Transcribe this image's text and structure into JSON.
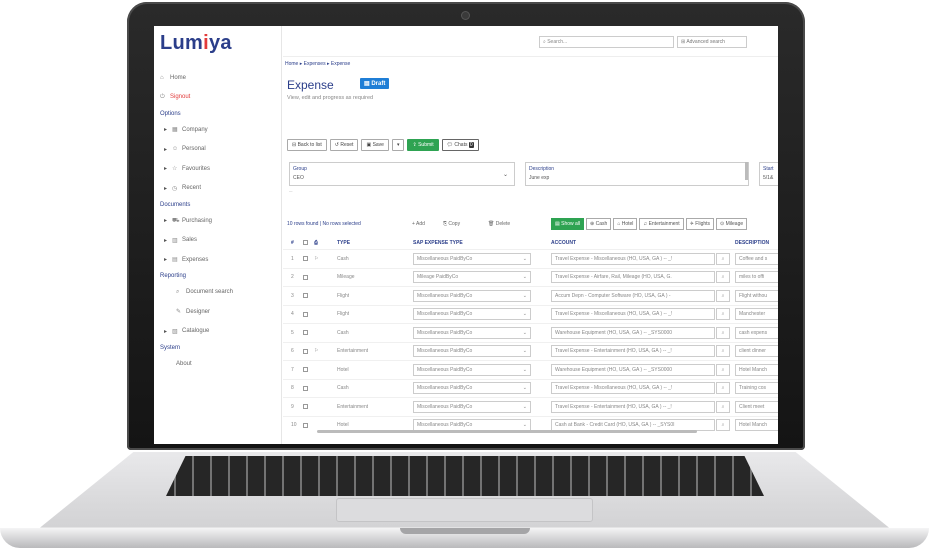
{
  "app": {
    "logo": "Lumiya",
    "logo_mark": "·"
  },
  "search": {
    "placeholder": "Search...",
    "advanced_label": "Advanced search"
  },
  "sidebar": {
    "items": [
      {
        "label": "Home",
        "icon": "home-icon",
        "style": "plain"
      },
      {
        "label": "Signout",
        "icon": "signout-icon",
        "style": "red"
      },
      {
        "label": "Options",
        "style": "section"
      },
      {
        "label": "Company",
        "icon": "building-icon",
        "style": "child"
      },
      {
        "label": "Personal",
        "icon": "person-icon",
        "style": "child"
      },
      {
        "label": "Favourites",
        "icon": "star-icon",
        "style": "child"
      },
      {
        "label": "Recent",
        "icon": "clock-icon",
        "style": "child"
      },
      {
        "label": "Documents",
        "style": "section"
      },
      {
        "label": "Purchasing",
        "icon": "cart-icon",
        "style": "child"
      },
      {
        "label": "Sales",
        "icon": "sales-icon",
        "style": "child"
      },
      {
        "label": "Expenses",
        "icon": "receipt-icon",
        "style": "child"
      },
      {
        "label": "Reporting",
        "style": "section"
      },
      {
        "label": "Document search",
        "icon": "doc-search-icon",
        "style": "sub"
      },
      {
        "label": "Designer",
        "icon": "designer-icon",
        "style": "sub"
      },
      {
        "label": "Catalogue",
        "icon": "catalogue-icon",
        "style": "child"
      },
      {
        "label": "System",
        "style": "section"
      },
      {
        "label": "About",
        "style": "sub"
      }
    ]
  },
  "breadcrumb": "Home ▸ Expenses ▸ Expense",
  "page": {
    "title": "Expense",
    "status_badge": "Draft",
    "subtitle": "View, edit and progress as required"
  },
  "toolbar": {
    "back": "Back to list",
    "reset": "Reset",
    "save": "Save",
    "submit": "Submit",
    "chats": "Chats",
    "chats_count": "0"
  },
  "header_fields": {
    "group_label": "Group",
    "group_value": "CEO",
    "description_label": "Description",
    "description_value": "June exp",
    "start_label": "Start",
    "start_value": "5/1&"
  },
  "grid": {
    "rows_found": "10 rows found | No rows selected",
    "add": "+ Add",
    "copy": "Copy",
    "delete": "Delete",
    "filters": [
      "Show all",
      "Cash",
      "Hotel",
      "Entertainment",
      "Flights",
      "Mileage"
    ],
    "columns": {
      "num": "#",
      "type": "TYPE",
      "sap": "SAP EXPENSE TYPE",
      "account": "ACCOUNT",
      "description": "DESCRIPTION"
    },
    "rows": [
      {
        "num": "1",
        "type": "Cash",
        "sap": "Miscellaneous PaidByCo",
        "account": "Travel Expense - Miscellaneous (HO, USA, GA ) -- _!",
        "description": "Coffee and s"
      },
      {
        "num": "2",
        "type": "Mileage",
        "sap": "Mileage PaidByCo",
        "account": "Travel Expense - Airfare, Rail, Mileage (HO, USA, G.",
        "description": "miles to offi"
      },
      {
        "num": "3",
        "type": "Flight",
        "sap": "Miscellaneous PaidByCo",
        "account": "Accum Depn - Computer Software (HO, USA, GA ) -",
        "description": "Flight withou"
      },
      {
        "num": "4",
        "type": "Flight",
        "sap": "Miscellaneous PaidByCo",
        "account": "Travel Expense - Miscellaneous (HO, USA, GA ) -- _!",
        "description": "Manchester"
      },
      {
        "num": "5",
        "type": "Cash",
        "sap": "Miscellaneous PaidByCo",
        "account": "Warehouse Equipment (HO, USA, GA ) -- _SYS0000",
        "description": "cash expens"
      },
      {
        "num": "6",
        "type": "Entertainment",
        "sap": "Miscellaneous PaidByCo",
        "account": "Travel Expense - Entertainment (HO, USA, GA ) -- _!",
        "description": "client dinner"
      },
      {
        "num": "7",
        "type": "Hotel",
        "sap": "Miscellaneous PaidByCo",
        "account": "Warehouse Equipment (HO, USA, GA ) -- _SYS0000",
        "description": "Hotel Manch"
      },
      {
        "num": "8",
        "type": "Cash",
        "sap": "Miscellaneous PaidByCo",
        "account": "Travel Expense - Miscellaneous (HO, USA, GA ) -- _!",
        "description": "Training cos"
      },
      {
        "num": "9",
        "type": "Entertainment",
        "sap": "Miscellaneous PaidByCo",
        "account": "Travel Expense - Entertainment (HO, USA, GA ) -- _!",
        "description": "Client meet"
      },
      {
        "num": "10",
        "type": "Hotel",
        "sap": "Miscellaneous PaidByCo",
        "account": "Cash at Bank - Credit Card (HO, USA, GA ) -- _SYS0I",
        "description": "Hotel Manch"
      }
    ]
  }
}
